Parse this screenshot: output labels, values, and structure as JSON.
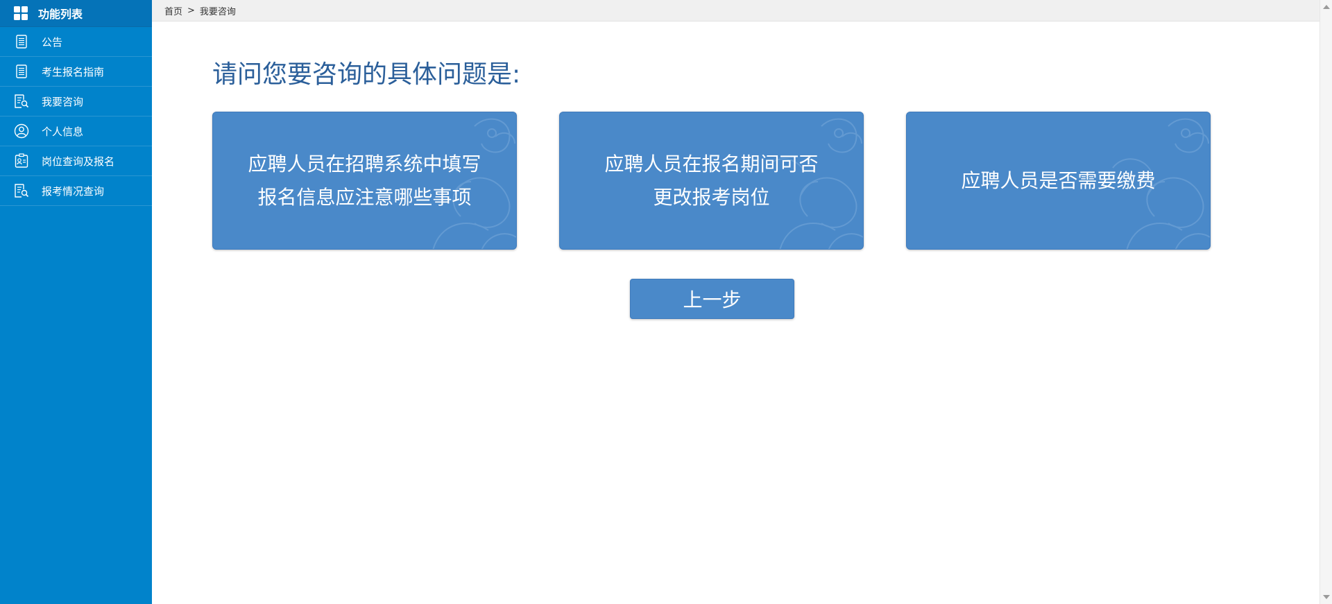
{
  "sidebar": {
    "header": {
      "label": "功能列表",
      "icon": "grid-icon"
    },
    "items": [
      {
        "label": "公告",
        "icon": "document-list-icon"
      },
      {
        "label": "考生报名指南",
        "icon": "document-list-icon"
      },
      {
        "label": "我要咨询",
        "icon": "document-search-icon"
      },
      {
        "label": "个人信息",
        "icon": "user-circle-icon"
      },
      {
        "label": "岗位查询及报名",
        "icon": "id-card-icon"
      },
      {
        "label": "报考情况查询",
        "icon": "document-search-icon"
      }
    ]
  },
  "breadcrumb": {
    "home": "首页",
    "separator": ">",
    "current": "我要咨询"
  },
  "main": {
    "title": "请问您要咨询的具体问题是:",
    "cards": [
      {
        "line1": "应聘人员在招聘系统中填写",
        "line2": "报名信息应注意哪些事项"
      },
      {
        "line1": "应聘人员在报名期间可否",
        "line2": "更改报考岗位"
      },
      {
        "line1": "应聘人员是否需要缴费",
        "line2": ""
      }
    ],
    "back_label": "上一步"
  },
  "colors": {
    "sidebar_bg": "#0183cb",
    "sidebar_header_bg": "#0573b8",
    "card_bg": "#4a89c9",
    "title_text": "#2b5f9a"
  }
}
